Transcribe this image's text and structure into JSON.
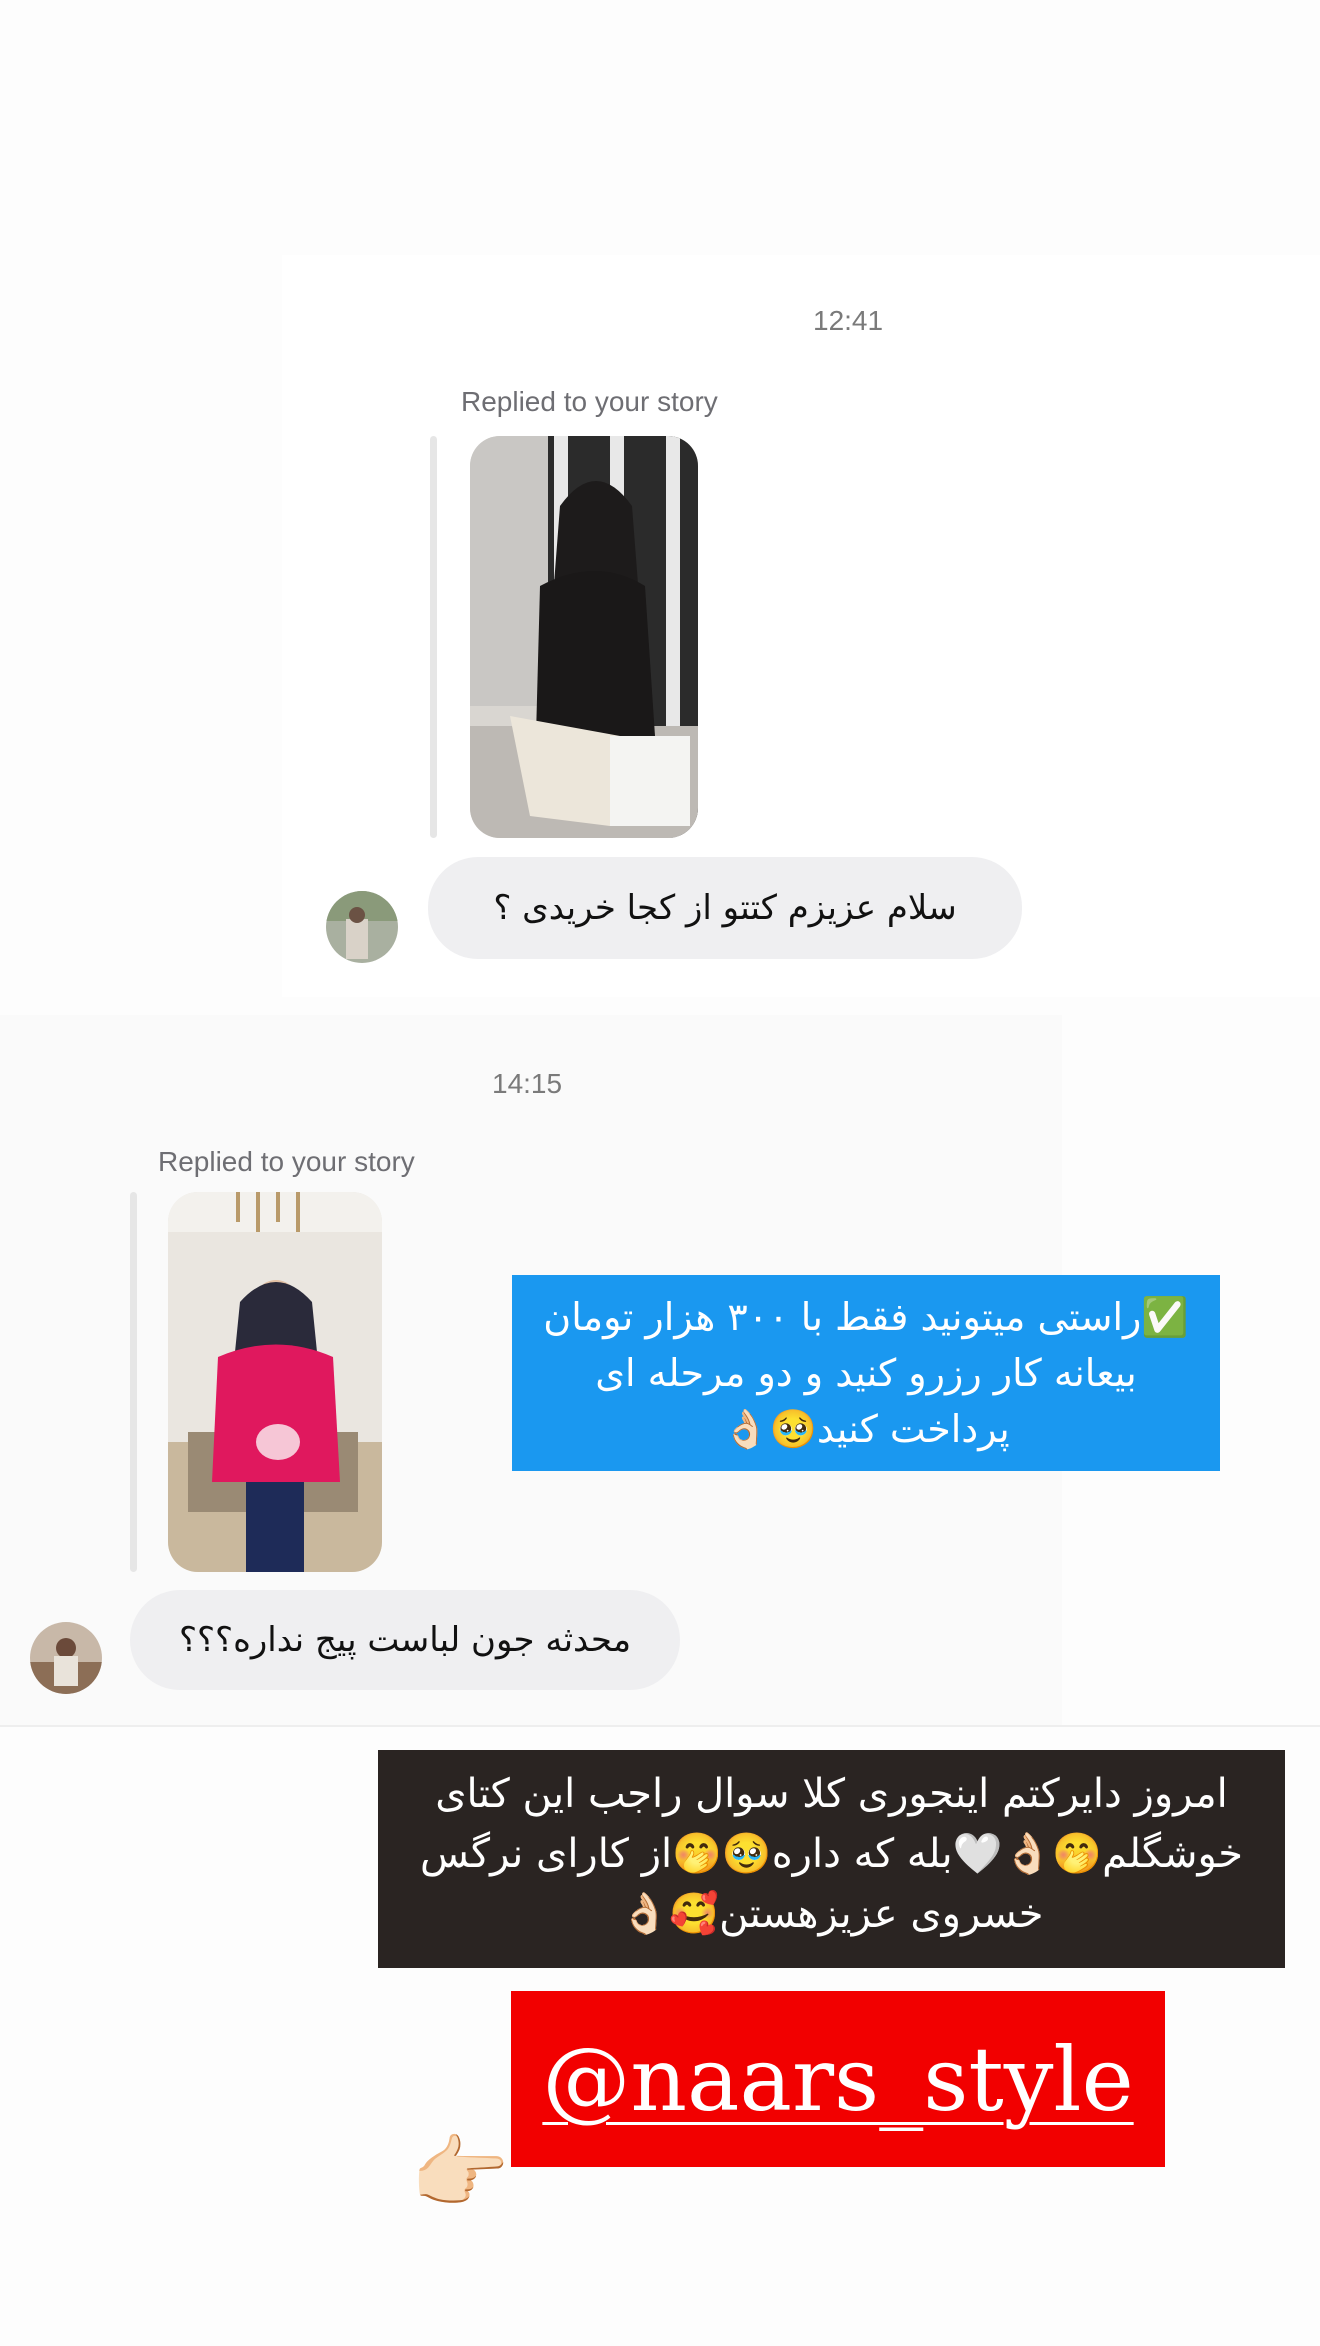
{
  "thread1": {
    "timestamp": "12:41",
    "reply_label": "Replied to your story",
    "message": "سلام عزیزم کتتو از کجا خریدی ؟"
  },
  "thread2": {
    "timestamp": "14:15",
    "reply_label": "Replied to your story",
    "message": "محدثه جون لباست پیج نداره؟؟؟"
  },
  "stickers": {
    "blue_text": "✅راستی میتونید فقط با ۳۰۰ هزار تومان بیعانه کار رزرو کنید و دو مرحله ای پرداخت کنید🥹👌🏻",
    "dark_text": "امروز دایرکتم اینجوری کلا سوال راجب این کتای خوشگلم🤭👌🏻🤍بله که داره🥹🤭از کارای نرگس خسروی عزیزهستن🥰👌🏻",
    "mention": "@naars_style",
    "pointer_emoji": "👉🏻"
  },
  "colors": {
    "blue_sticker": "#1a98f0",
    "dark_sticker": "#2a2422",
    "red_sticker": "#f20000",
    "bubble": "#efeff1"
  }
}
